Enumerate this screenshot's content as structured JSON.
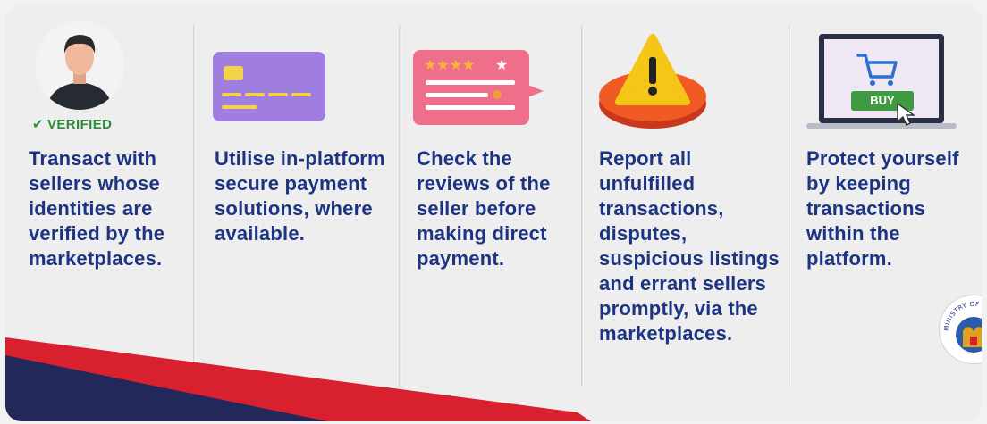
{
  "verified_label": "VERIFIED",
  "tips": [
    {
      "text": "Transact with sellers whose identities are verified by the marketplaces."
    },
    {
      "text": "Utilise in-platform secure payment solutions, where available."
    },
    {
      "text": "Check the reviews of the seller before making direct payment."
    },
    {
      "text": "Report all unfulfilled transactions, disputes, suspicious listings and errant sellers promptly, via the marketplaces."
    },
    {
      "text": "Protect yourself by keeping transactions within the platform."
    }
  ],
  "buy_button_label": "BUY",
  "seal_text": "MINISTRY OF HOME AFFAIRS",
  "colors": {
    "text": "#1c3483",
    "verified": "#2e8b3c",
    "navy": "#23285a",
    "red": "#d8202f"
  },
  "icons": [
    "user-avatar-icon",
    "credit-card-icon",
    "review-stars-icon",
    "warning-icon",
    "laptop-cart-icon",
    "ministry-seal-icon"
  ]
}
